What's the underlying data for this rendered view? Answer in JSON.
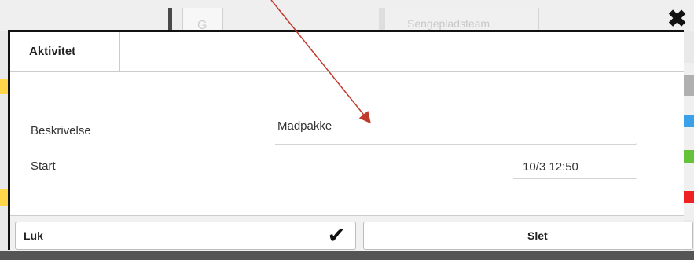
{
  "background": {
    "partial_cell_text": "G",
    "team_tab": "Sengepladsteam"
  },
  "dialog": {
    "tab_label": "Aktivitet",
    "close_icon": "close-icon",
    "fields": {
      "description_label": "Beskrivelse",
      "description_value": "Madpakke",
      "start_label": "Start",
      "start_value": "10/3 12:50"
    },
    "footer": {
      "close_label": "Luk",
      "confirm_icon": "checkmark-icon",
      "delete_label": "Slet"
    }
  },
  "colors": {
    "swatch_gray": "#b0b0b0",
    "swatch_blue": "#3aa0e8",
    "swatch_green": "#66c23a",
    "swatch_red": "#ee2222",
    "annotation_arrow": "#c0392b"
  }
}
